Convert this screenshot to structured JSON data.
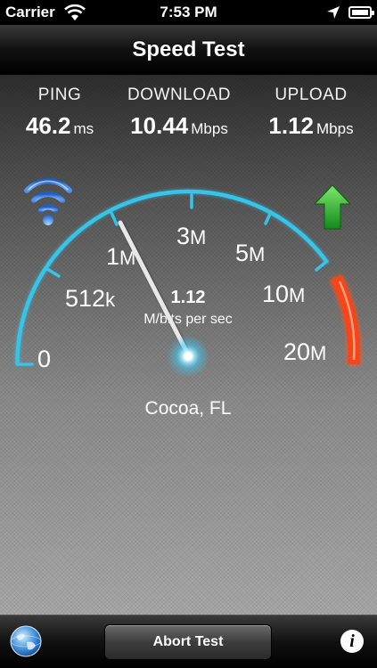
{
  "status_bar": {
    "carrier": "Carrier",
    "time": "7:53 PM",
    "icons": [
      "wifi-icon",
      "location-arrow-icon",
      "battery-icon"
    ]
  },
  "navbar": {
    "title": "Speed Test"
  },
  "metrics": {
    "ping": {
      "label": "PING",
      "value": "46.2",
      "unit": "ms"
    },
    "download": {
      "label": "DOWNLOAD",
      "value": "10.44",
      "unit": "Mbps"
    },
    "upload": {
      "label": "UPLOAD",
      "value": "1.12",
      "unit": "Mbps"
    }
  },
  "gauge": {
    "tick_labels": [
      {
        "num": "0",
        "suffix": ""
      },
      {
        "num": "512",
        "suffix": "k"
      },
      {
        "num": "1",
        "suffix": "M"
      },
      {
        "num": "3",
        "suffix": "M"
      },
      {
        "num": "5",
        "suffix": "M"
      },
      {
        "num": "10",
        "suffix": "M"
      },
      {
        "num": "20",
        "suffix": "M"
      }
    ],
    "current_value": "1.12",
    "current_unit": "M/bits per sec",
    "location": "Cocoa, FL",
    "mode_icon": "upload-arrow-icon",
    "connection_icon": "wifi-signal-icon",
    "colors": {
      "arc": "#35c4ea",
      "red_zone": "#f5461a",
      "needle": "#e8e8e8"
    }
  },
  "toolbar": {
    "abort_label": "Abort Test",
    "info_label": "i",
    "globe_icon": "globe-icon"
  }
}
